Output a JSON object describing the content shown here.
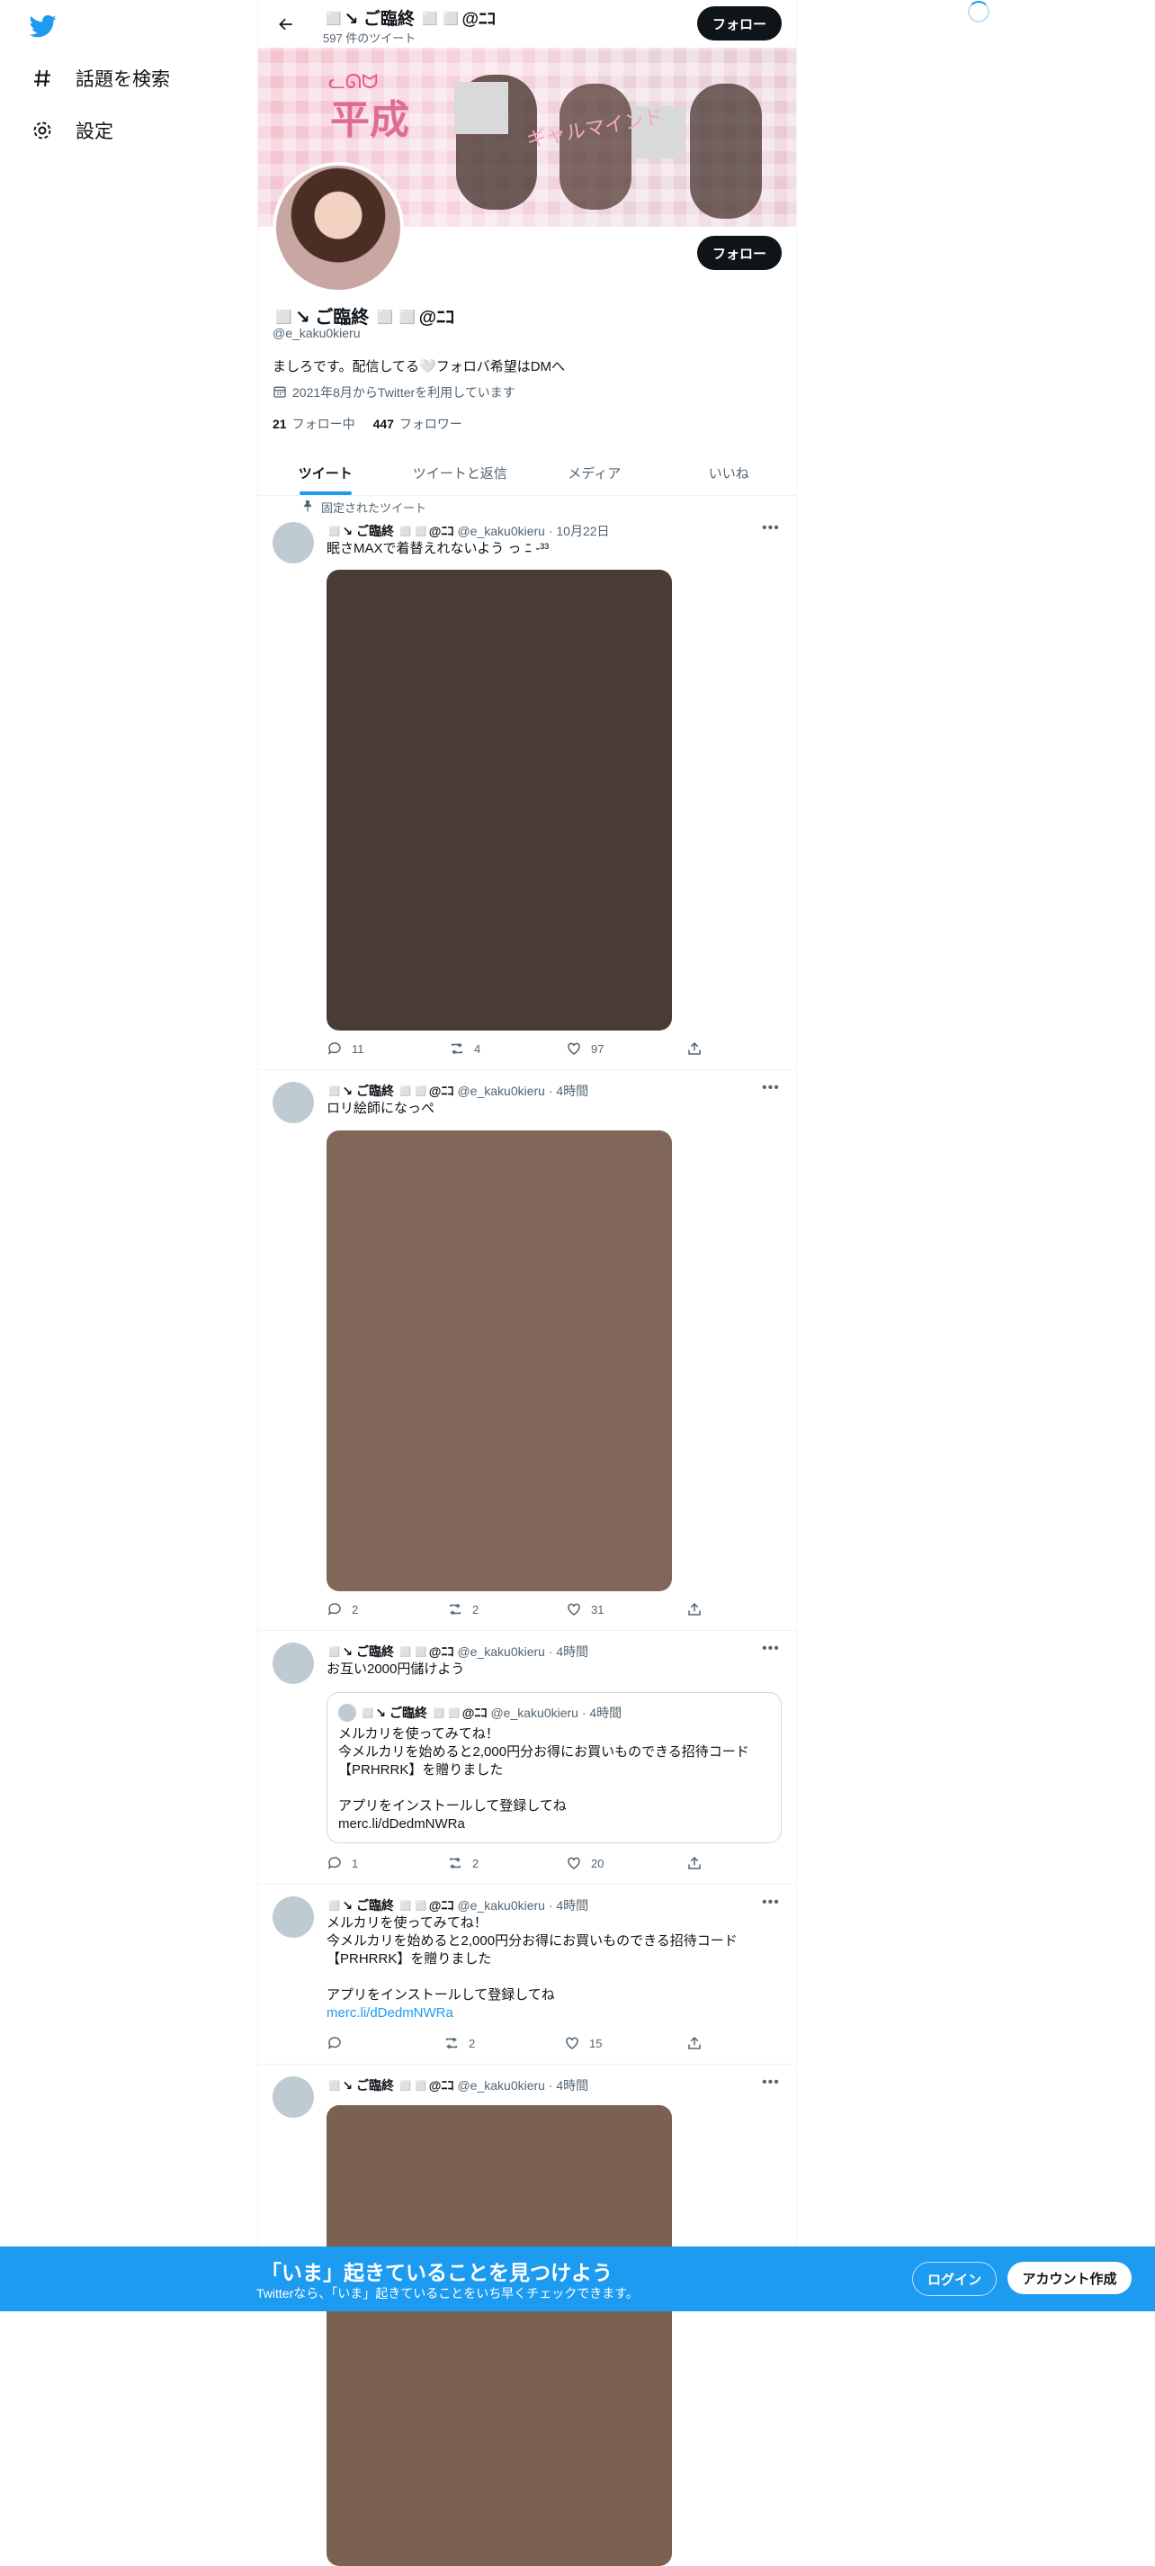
{
  "nav": {
    "items": [
      {
        "icon": "hashtag-icon",
        "label": "話題を検索"
      },
      {
        "icon": "gear-icon",
        "label": "設定"
      }
    ]
  },
  "header": {
    "name": "◻️↘ ご臨終 ◻️◻️@ﾆｺ",
    "tweet_count": "597 件のツイート",
    "follow_label": "フォロー"
  },
  "profile": {
    "name": "◻️↘ ご臨終 ◻️◻️@ﾆｺ",
    "handle": "@e_kaku0kieru",
    "bio": "ましろです。配信してる🤍フォロバ希望はDMへ",
    "joined": "2021年8月からTwitterを利用しています",
    "following_count": "21",
    "following_label": "フォロー中",
    "followers_count": "447",
    "followers_label": "フォロワー",
    "follow_label": "フォロー"
  },
  "tabs": [
    "ツイート",
    "ツイートと返信",
    "メディア",
    "いいね"
  ],
  "pinned_label": "固定されたツイート",
  "tweets": [
    {
      "name": "◻️↘ ご臨終 ◻️◻️@ﾆｺ",
      "meta": "@e_kaku0kieru · 10月22日",
      "text": "眠さMAXで着替えれないよう っ ﾆ -³³",
      "media_color": "#4a3b35",
      "replies": "11",
      "retweets": "4",
      "likes": "97"
    },
    {
      "name": "◻️↘ ご臨終 ◻️◻️@ﾆｺ",
      "meta": "@e_kaku0kieru · 4時間",
      "text": "ロリ絵師になっぺ",
      "media_color": "#806759",
      "replies": "2",
      "retweets": "2",
      "likes": "31"
    },
    {
      "name": "◻️↘ ご臨終 ◻️◻️@ﾆｺ",
      "meta": "@e_kaku0kieru · 4時間",
      "text": "お互い2000円儲けよう",
      "quote": {
        "name": "◻️↘ ご臨終 ◻️◻️@ﾆｺ",
        "meta": "@e_kaku0kieru · 4時間",
        "text": "メルカリを使ってみてね！\n今メルカリを始めると2,000円分お得にお買いものできる招待コード\n【PRHRRK】を贈りました\n\nアプリをインストールして登録してね\nmerc.li/dDedmNWRa"
      },
      "replies": "1",
      "retweets": "2",
      "likes": "20"
    },
    {
      "name": "◻️↘ ご臨終 ◻️◻️@ﾆｺ",
      "meta": "@e_kaku0kieru · 4時間",
      "text": "メルカリを使ってみてね！\n今メルカリを始めると2,000円分お得にお買いものできる招待コード\n【PRHRRK】を贈りました\n\nアプリをインストールして登録してね",
      "link": "merc.li/dDedmNWRa",
      "replies": "",
      "retweets": "2",
      "likes": "15"
    },
    {
      "name": "◻️↘ ご臨終 ◻️◻️@ﾆｺ",
      "meta": "@e_kaku0kieru · 4時間",
      "media_color": "#7a6152"
    }
  ],
  "bottom_bar": {
    "title": "「いま」起きていることを見つけよう",
    "subtitle": "Twitterなら、「いま」起きていることをいち早くチェックできます。",
    "login": "ログイン",
    "signup": "アカウント作成"
  },
  "colors": {
    "accent": "#1d9bf0",
    "text": "#0f1419",
    "muted": "#536471"
  }
}
